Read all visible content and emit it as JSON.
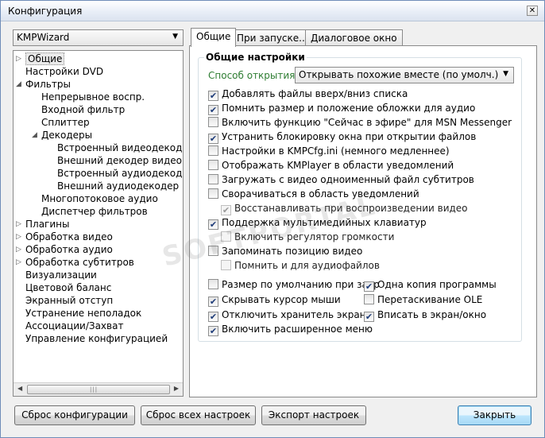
{
  "window": {
    "title": "Конфигурация",
    "close_label": "✕"
  },
  "profile": {
    "value": "KMPWizard"
  },
  "tree": [
    {
      "label": "Общие",
      "exp": "▷",
      "selected": true
    },
    {
      "label": "Настройки DVD"
    },
    {
      "label": "Фильтры",
      "exp": "◢"
    },
    {
      "label": "Непрерывное воспр."
    },
    {
      "label": "Входной фильтр"
    },
    {
      "label": "Сплиттер"
    },
    {
      "label": "Декодеры",
      "exp": "◢"
    },
    {
      "label": "Встроенный видеодекодер"
    },
    {
      "label": "Внешний декодер видео"
    },
    {
      "label": "Встроенный аудиодекодер"
    },
    {
      "label": "Внешний аудиодекодер"
    },
    {
      "label": "Многопотоковое аудио"
    },
    {
      "label": "Диспетчер фильтров"
    },
    {
      "label": "Плагины",
      "exp": "▷"
    },
    {
      "label": "Обработка видео",
      "exp": "▷"
    },
    {
      "label": "Обработка аудио",
      "exp": "▷"
    },
    {
      "label": "Обработка субтитров",
      "exp": "▷"
    },
    {
      "label": "Визуализации"
    },
    {
      "label": "Цветовой баланс"
    },
    {
      "label": "Экранный отступ"
    },
    {
      "label": "Устранение неполадок"
    },
    {
      "label": "Ассоциации/Захват"
    },
    {
      "label": "Управление конфигурацией"
    }
  ],
  "tabs": [
    {
      "label": "Общие",
      "active": true
    },
    {
      "label": "При запуске..."
    },
    {
      "label": "Диалоговое окно"
    }
  ],
  "general": {
    "group_title": "Общие настройки",
    "open_label": "Способ открытия:",
    "open_value": "Открывать похожие вместе (по умолч.)",
    "options": [
      {
        "label": "Добавлять файлы вверх/вниз списка",
        "checked": true
      },
      {
        "label": "Помнить размер и положение обложки для аудио",
        "checked": true
      },
      {
        "label": "Включить функцию \"Сейчас в эфире\" для MSN Messenger",
        "checked": false
      },
      {
        "label": "Устранить блокировку окна при открытии файлов",
        "checked": true
      },
      {
        "label": "Настройки в KMPCfg.ini (немного медленнее)",
        "checked": false
      },
      {
        "label": "Отображать KMPlayer в области уведомлений",
        "checked": false
      },
      {
        "label": "Загружать с видео одноименный файл субтитров",
        "checked": false
      },
      {
        "label": "Сворачиваться в область уведомлений",
        "checked": false
      },
      {
        "label": "Восстанавливать при воспроизведении видео",
        "checked": true,
        "disabled": true
      },
      {
        "label": "Поддержка мультимедийных клавиатур",
        "checked": true
      },
      {
        "label": "Включить регулятор громкости",
        "checked": false,
        "disabled": true
      },
      {
        "label": "Запоминать позицию видео",
        "checked": false
      },
      {
        "label": "Помнить и для аудиофайлов",
        "checked": false,
        "disabled": true
      },
      {
        "label": "Размер по умолчанию при закр",
        "checked": false
      },
      {
        "label": "Одна копия программы",
        "checked": true
      },
      {
        "label": "Скрывать курсор мыши",
        "checked": true
      },
      {
        "label": "Перетаскивание OLE",
        "checked": false
      },
      {
        "label": "Отключить хранитель экрана",
        "checked": true
      },
      {
        "label": "Вписать в экран/окно",
        "checked": true
      },
      {
        "label": "Включить расширенное меню",
        "checked": true
      }
    ]
  },
  "buttons": {
    "reset_config": "Сброс конфигурации",
    "reset_all": "Сброс всех настроек",
    "export": "Экспорт настроек",
    "close": "Закрыть"
  },
  "check_glyph": "✔",
  "watermark": "SOFTPORTAL"
}
